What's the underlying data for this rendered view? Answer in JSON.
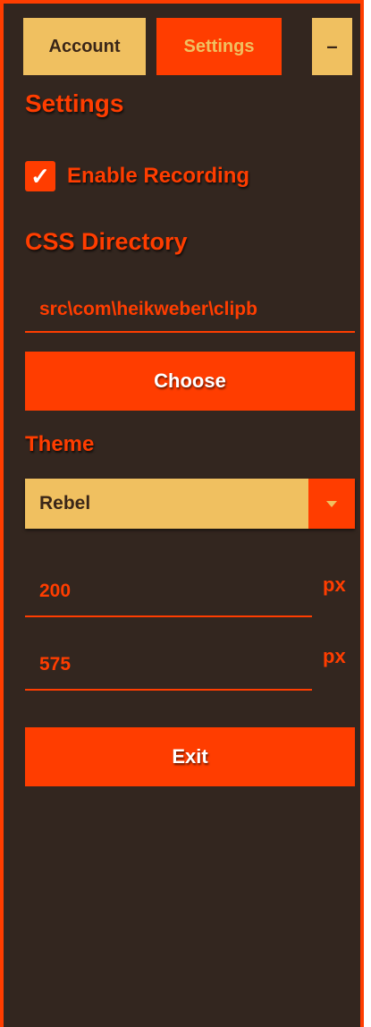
{
  "tabs": {
    "account": "Account",
    "settings": "Settings",
    "minimize": "–"
  },
  "settings": {
    "title": "Settings",
    "enable_recording_label": "Enable Recording",
    "enable_recording_checked": true,
    "css_directory_label": "CSS Directory",
    "css_directory_value": "src\\com\\heikweber\\clipb",
    "choose_label": "Choose",
    "theme_label": "Theme",
    "theme_value": "Rebel",
    "width_value": "200",
    "height_value": "575",
    "unit": "px",
    "exit_label": "Exit"
  },
  "colors": {
    "accent": "#ff3d00",
    "background": "#33261f",
    "tab_light": "#f0c060"
  }
}
